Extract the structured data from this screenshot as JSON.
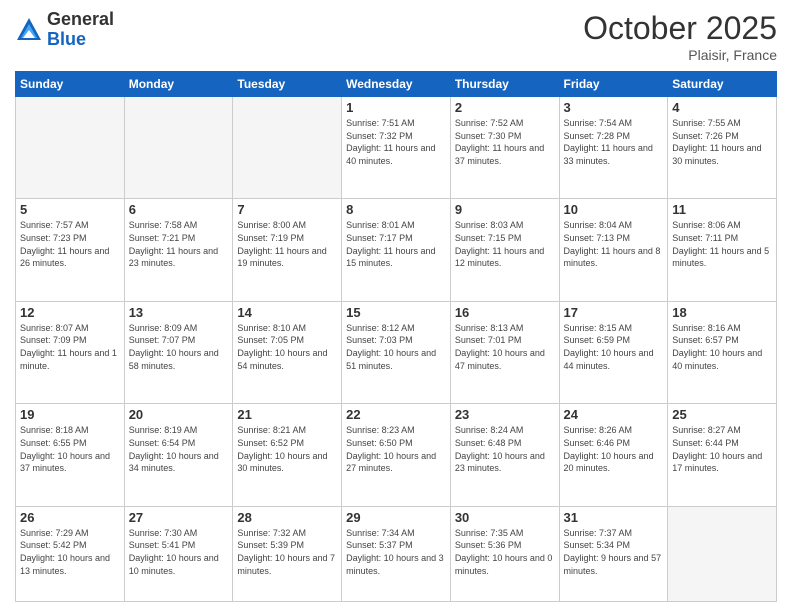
{
  "header": {
    "logo_general": "General",
    "logo_blue": "Blue",
    "month_title": "October 2025",
    "location": "Plaisir, France"
  },
  "weekdays": [
    "Sunday",
    "Monday",
    "Tuesday",
    "Wednesday",
    "Thursday",
    "Friday",
    "Saturday"
  ],
  "weeks": [
    [
      {
        "day": "",
        "info": ""
      },
      {
        "day": "",
        "info": ""
      },
      {
        "day": "",
        "info": ""
      },
      {
        "day": "1",
        "info": "Sunrise: 7:51 AM\nSunset: 7:32 PM\nDaylight: 11 hours\nand 40 minutes."
      },
      {
        "day": "2",
        "info": "Sunrise: 7:52 AM\nSunset: 7:30 PM\nDaylight: 11 hours\nand 37 minutes."
      },
      {
        "day": "3",
        "info": "Sunrise: 7:54 AM\nSunset: 7:28 PM\nDaylight: 11 hours\nand 33 minutes."
      },
      {
        "day": "4",
        "info": "Sunrise: 7:55 AM\nSunset: 7:26 PM\nDaylight: 11 hours\nand 30 minutes."
      }
    ],
    [
      {
        "day": "5",
        "info": "Sunrise: 7:57 AM\nSunset: 7:23 PM\nDaylight: 11 hours\nand 26 minutes."
      },
      {
        "day": "6",
        "info": "Sunrise: 7:58 AM\nSunset: 7:21 PM\nDaylight: 11 hours\nand 23 minutes."
      },
      {
        "day": "7",
        "info": "Sunrise: 8:00 AM\nSunset: 7:19 PM\nDaylight: 11 hours\nand 19 minutes."
      },
      {
        "day": "8",
        "info": "Sunrise: 8:01 AM\nSunset: 7:17 PM\nDaylight: 11 hours\nand 15 minutes."
      },
      {
        "day": "9",
        "info": "Sunrise: 8:03 AM\nSunset: 7:15 PM\nDaylight: 11 hours\nand 12 minutes."
      },
      {
        "day": "10",
        "info": "Sunrise: 8:04 AM\nSunset: 7:13 PM\nDaylight: 11 hours\nand 8 minutes."
      },
      {
        "day": "11",
        "info": "Sunrise: 8:06 AM\nSunset: 7:11 PM\nDaylight: 11 hours\nand 5 minutes."
      }
    ],
    [
      {
        "day": "12",
        "info": "Sunrise: 8:07 AM\nSunset: 7:09 PM\nDaylight: 11 hours\nand 1 minute."
      },
      {
        "day": "13",
        "info": "Sunrise: 8:09 AM\nSunset: 7:07 PM\nDaylight: 10 hours\nand 58 minutes."
      },
      {
        "day": "14",
        "info": "Sunrise: 8:10 AM\nSunset: 7:05 PM\nDaylight: 10 hours\nand 54 minutes."
      },
      {
        "day": "15",
        "info": "Sunrise: 8:12 AM\nSunset: 7:03 PM\nDaylight: 10 hours\nand 51 minutes."
      },
      {
        "day": "16",
        "info": "Sunrise: 8:13 AM\nSunset: 7:01 PM\nDaylight: 10 hours\nand 47 minutes."
      },
      {
        "day": "17",
        "info": "Sunrise: 8:15 AM\nSunset: 6:59 PM\nDaylight: 10 hours\nand 44 minutes."
      },
      {
        "day": "18",
        "info": "Sunrise: 8:16 AM\nSunset: 6:57 PM\nDaylight: 10 hours\nand 40 minutes."
      }
    ],
    [
      {
        "day": "19",
        "info": "Sunrise: 8:18 AM\nSunset: 6:55 PM\nDaylight: 10 hours\nand 37 minutes."
      },
      {
        "day": "20",
        "info": "Sunrise: 8:19 AM\nSunset: 6:54 PM\nDaylight: 10 hours\nand 34 minutes."
      },
      {
        "day": "21",
        "info": "Sunrise: 8:21 AM\nSunset: 6:52 PM\nDaylight: 10 hours\nand 30 minutes."
      },
      {
        "day": "22",
        "info": "Sunrise: 8:23 AM\nSunset: 6:50 PM\nDaylight: 10 hours\nand 27 minutes."
      },
      {
        "day": "23",
        "info": "Sunrise: 8:24 AM\nSunset: 6:48 PM\nDaylight: 10 hours\nand 23 minutes."
      },
      {
        "day": "24",
        "info": "Sunrise: 8:26 AM\nSunset: 6:46 PM\nDaylight: 10 hours\nand 20 minutes."
      },
      {
        "day": "25",
        "info": "Sunrise: 8:27 AM\nSunset: 6:44 PM\nDaylight: 10 hours\nand 17 minutes."
      }
    ],
    [
      {
        "day": "26",
        "info": "Sunrise: 7:29 AM\nSunset: 5:42 PM\nDaylight: 10 hours\nand 13 minutes."
      },
      {
        "day": "27",
        "info": "Sunrise: 7:30 AM\nSunset: 5:41 PM\nDaylight: 10 hours\nand 10 minutes."
      },
      {
        "day": "28",
        "info": "Sunrise: 7:32 AM\nSunset: 5:39 PM\nDaylight: 10 hours\nand 7 minutes."
      },
      {
        "day": "29",
        "info": "Sunrise: 7:34 AM\nSunset: 5:37 PM\nDaylight: 10 hours\nand 3 minutes."
      },
      {
        "day": "30",
        "info": "Sunrise: 7:35 AM\nSunset: 5:36 PM\nDaylight: 10 hours\nand 0 minutes."
      },
      {
        "day": "31",
        "info": "Sunrise: 7:37 AM\nSunset: 5:34 PM\nDaylight: 9 hours\nand 57 minutes."
      },
      {
        "day": "",
        "info": ""
      }
    ]
  ]
}
